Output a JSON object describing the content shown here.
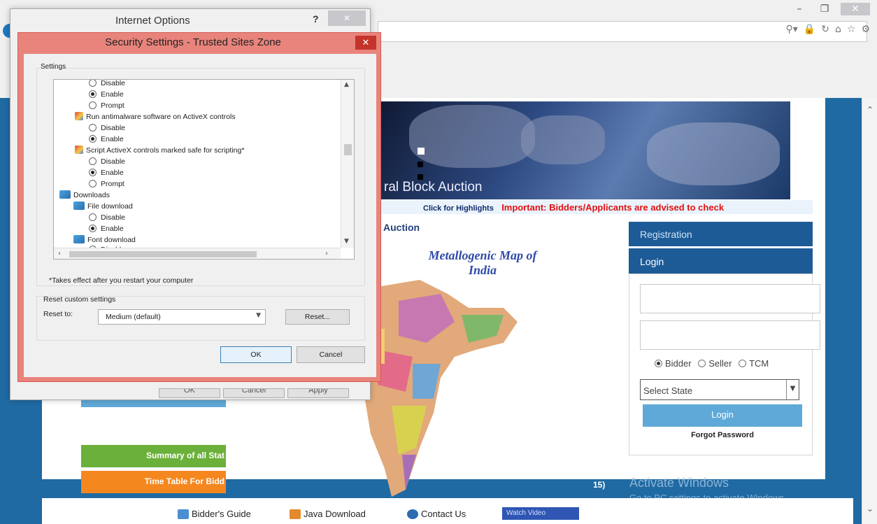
{
  "browser": {
    "window_controls": {
      "minimize": "–",
      "restore": "❐",
      "close": "✕"
    },
    "address_icons": [
      "⚲▾",
      "🔒",
      "↻",
      "⌂",
      "☆",
      "⚙"
    ]
  },
  "page": {
    "banner_title": "ral Block Auction",
    "ticker_highlights": "Click for Highlights",
    "ticker_important": "Important: Bidders/Applicants are advised to check",
    "section_heading": "Auction",
    "map_title": "Metallogenic Map of India",
    "registration_tab": "Registration",
    "login_tab": "Login",
    "roles": [
      "Bidder",
      "Seller",
      "TCM"
    ],
    "selected_role": "Bidder",
    "state_select": "Select State",
    "login_button": "Login",
    "forgot_password": "Forgot Password",
    "summary_button": "Summary of all Stat",
    "timetable_button": "Time Table For Bidd",
    "fragment_15": "15)",
    "activate_windows": "Activate Windows",
    "activate_windows_sub": "Go to PC settings to activate Windows",
    "footer": {
      "bidders_guide": "Bidder's Guide",
      "java_download": "Java Download",
      "contact_us": "Contact Us",
      "watch_video": "Watch Video"
    },
    "colors": {
      "page_blue": "#1f6aa3",
      "login_blue": "#5fa9d8",
      "summary_green": "#6bb03a",
      "timetable_orange": "#f5871f",
      "ticker_red": "#e01010"
    }
  },
  "internet_options": {
    "title": "Internet Options",
    "help": "?",
    "close": "✕",
    "buttons": [
      "OK",
      "Cancel",
      "Apply"
    ]
  },
  "security_dialog": {
    "title": "Security Settings - Trusted Sites Zone",
    "close": "✕",
    "settings_label": "Settings",
    "tree": {
      "r1": "Disable",
      "r2": "Enable",
      "r3": "Prompt",
      "g1": "Run antimalware software on ActiveX controls",
      "r4": "Disable",
      "r5": "Enable",
      "g2": "Script ActiveX controls marked safe for scripting*",
      "r6": "Disable",
      "r7": "Enable",
      "r8": "Prompt",
      "g3": "Downloads",
      "g4": "File download",
      "r9": "Disable",
      "r10": "Enable",
      "g5": "Font download",
      "r11": "Disable"
    },
    "takes_effect": "*Takes effect after you restart your computer",
    "reset_label": "Reset custom settings",
    "reset_to": "Reset to:",
    "reset_value": "Medium (default)",
    "reset_button": "Reset...",
    "ok": "OK",
    "cancel": "Cancel"
  }
}
